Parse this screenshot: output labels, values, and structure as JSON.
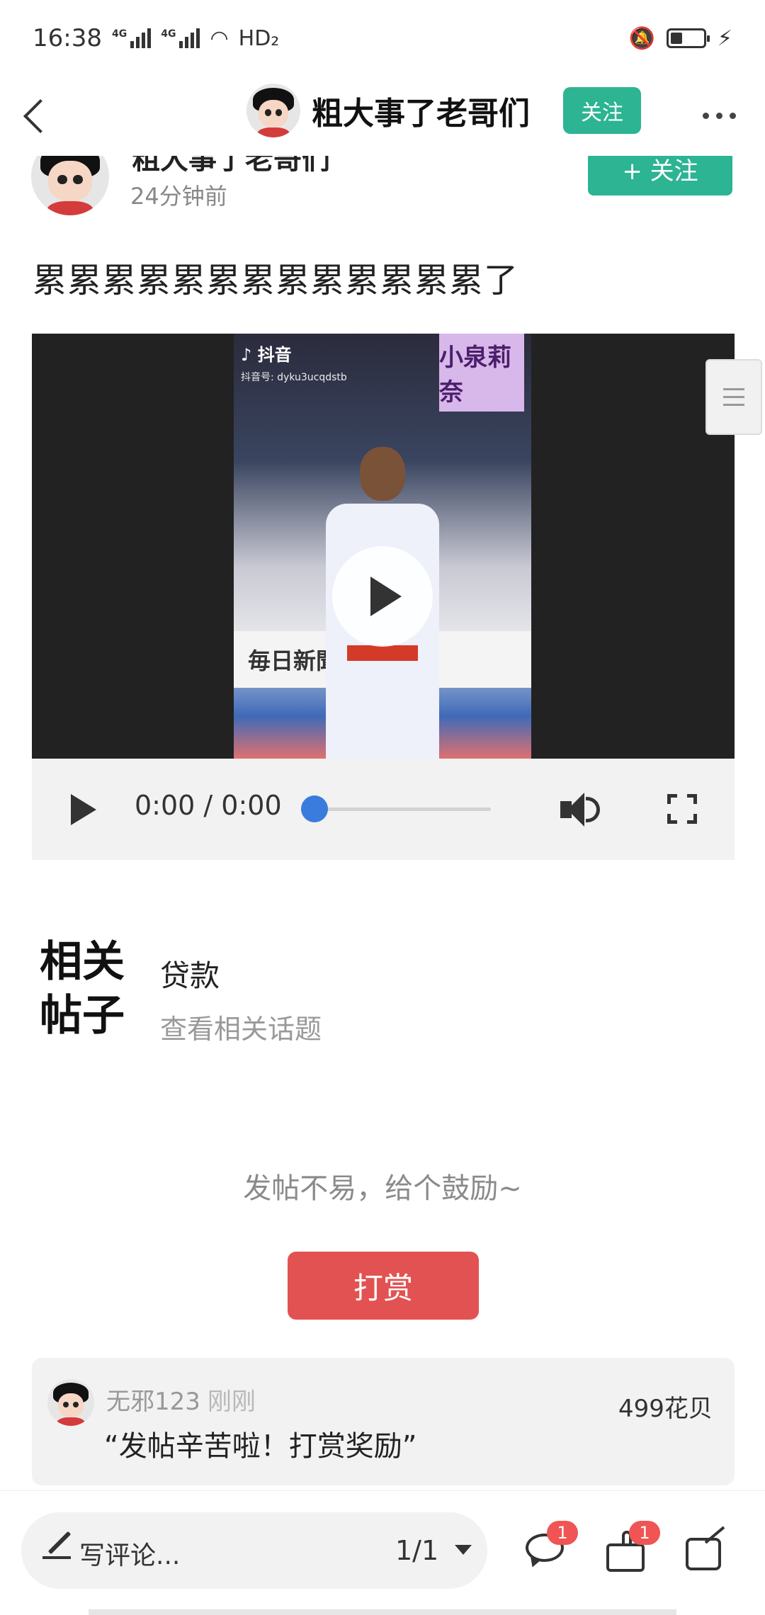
{
  "status_bar": {
    "time": "16:38",
    "network_1": "4G",
    "network_2": "4G",
    "hd": "HD₂"
  },
  "header": {
    "title": "粗大事了老哥们",
    "follow_label": "关注"
  },
  "author": {
    "name": "粗大事了老哥们",
    "time": "24分钟前",
    "follow_label": "+ 关注"
  },
  "post": {
    "text": "累累累累累累累累累累累累累了"
  },
  "video": {
    "watermark_app": "抖音",
    "watermark_id": "抖音号: dyku3ucqdstb",
    "banner_text": "小泉莉奈",
    "wall_text": "毎日新聞",
    "time_display": "0:00 / 0:00",
    "progress": 0
  },
  "related": {
    "heading_line1": "相关",
    "heading_line2": "帖子",
    "tag": "贷款",
    "link": "查看相关话题"
  },
  "reward": {
    "encourage_text": "发帖不易，给个鼓励~",
    "button_label": "打赏"
  },
  "tip_record": {
    "user": "无邪123",
    "time": "刚刚",
    "message": "“发帖辛苦啦！打赏奖励”",
    "amount": "499花贝"
  },
  "bottom_bar": {
    "comment_placeholder": "写评论...",
    "page_indicator": "1/1",
    "comment_badge": "1",
    "like_badge": "1"
  },
  "colors": {
    "accent_green": "#2cb493",
    "reward_red": "#e35252",
    "progress_blue": "#3a7bde",
    "badge_red": "#f05454"
  }
}
